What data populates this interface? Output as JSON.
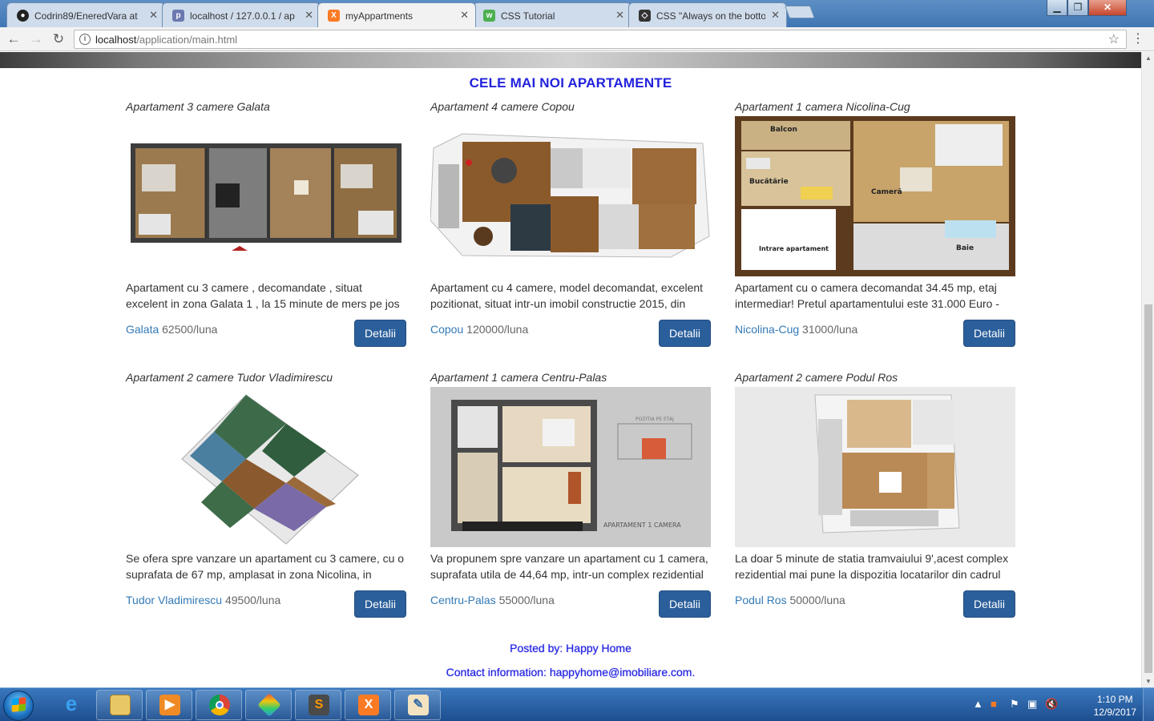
{
  "browser": {
    "tabs": [
      {
        "title": "Codrin89/EneredVara at",
        "icon": "github-icon",
        "color": "#222222",
        "active": false
      },
      {
        "title": "localhost / 127.0.0.1 / ap",
        "icon": "phpmyadmin-icon",
        "color": "#6c78af",
        "active": false
      },
      {
        "title": "myAppartments",
        "icon": "xampp-icon",
        "color": "#fb7a24",
        "active": true
      },
      {
        "title": "CSS Tutorial",
        "icon": "w3schools-icon",
        "color": "#4caf50",
        "active": false
      },
      {
        "title": "CSS \"Always on the botto",
        "icon": "codepen-icon",
        "color": "#333333",
        "active": false
      }
    ],
    "url_host": "localhost",
    "url_path": "/application/main.html"
  },
  "page": {
    "section_title": "CELE MAI NOI APARTAMENTE",
    "details_label": "Detalii",
    "listings": [
      {
        "title": "Apartament 3 camere Galata",
        "description": "Apartament cu 3 camere , decomandate , situat excelent in zona Galata 1 , la 15 minute de mers pe jos",
        "location": "Galata",
        "price": "62500/luna",
        "image": "floorplan-galata"
      },
      {
        "title": "Apartament 4 camere Copou",
        "description": "Apartament cu 4 camere, model decomandat, excelent pozitionat, situat intr-un imobil constructie 2015, din",
        "location": "Copou",
        "price": "120000/luna",
        "image": "floorplan-copou"
      },
      {
        "title": "Apartament 1 camera Nicolina-Cug",
        "description": "Apartament cu o camera decomandat 34.45 mp, etaj intermediar! Pretul apartamentului este 31.000 Euro -",
        "location": "Nicolina-Cug",
        "price": "31000/luna",
        "image": "floorplan-nicolina",
        "plan_labels": {
          "balcony": "Balcon",
          "kitchen": "Bucătărie",
          "room": "Cameră",
          "bath": "Baie",
          "entrance": "Intrare apartament"
        }
      },
      {
        "title": "Apartament 2 camere Tudor Vladimirescu",
        "description": "Se ofera spre vanzare un apartament cu 3 camere, cu o suprafata de 67 mp, amplasat in zona Nicolina, in",
        "location": "Tudor Vladimirescu",
        "price": "49500/luna",
        "image": "floorplan-tudor"
      },
      {
        "title": "Apartament 1 camera Centru-Palas",
        "description": "Va propunem spre vanzare un apartament cu 1 camera, suprafata utila de 44,64 mp, intr-un complex rezidential",
        "location": "Centru-Palas",
        "price": "55000/luna",
        "image": "floorplan-palas",
        "plan_labels": {
          "position": "POZITIA PE ETAJ",
          "caption": "APARTAMENT 1 CAMERA"
        }
      },
      {
        "title": "Apartament 2 camere Podul Ros",
        "description": "La doar 5 minute de statia tramvaiului 9',acest complex rezidential mai pune la dispozitia locatarilor din cadrul",
        "location": "Podul Ros",
        "price": "50000/luna",
        "image": "floorplan-podul-ros"
      }
    ],
    "footer": {
      "posted_by": "Posted by: Happy Home",
      "contact_prefix": "Contact information: ",
      "contact_email": "happyhome@imobiliare.com",
      "contact_suffix": "."
    }
  },
  "taskbar": {
    "apps": [
      "windows-explorer-icon",
      "internet-explorer-icon",
      "file-explorer-icon",
      "media-player-icon",
      "chrome-icon",
      "app-icon",
      "sublime-text-icon",
      "xampp-icon",
      "paint-icon"
    ],
    "clock_time": "1:10 PM",
    "clock_date": "12/9/2017"
  }
}
